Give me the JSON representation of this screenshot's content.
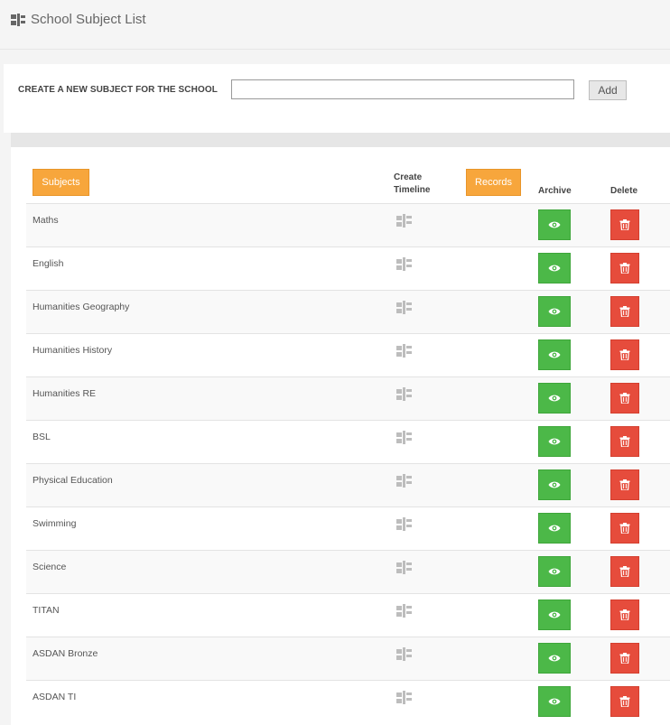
{
  "header": {
    "title": "School Subject List",
    "logo_icon": "timeline-flag-icon"
  },
  "create": {
    "label": "CREATE A NEW SUBJECT FOR THE SCHOOL",
    "input_value": "",
    "add_label": "Add"
  },
  "list": {
    "subjects_button": "Subjects",
    "timeline_header": "Create Timeline",
    "records_button": "Records",
    "archive_header": "Archive",
    "delete_header": "Delete",
    "subjects": [
      "Maths",
      "English",
      "Humanities Geography",
      "Humanities History",
      "Humanities RE",
      "BSL",
      "Physical Education",
      "Swimming",
      "Science",
      "TITAN",
      "ASDAN Bronze",
      "ASDAN TI"
    ]
  },
  "colors": {
    "archive_green": "#4cb848",
    "delete_red": "#e64c3c",
    "accent_orange": "#f7a63c"
  },
  "icons": {
    "timeline": "timeline-flag-icon",
    "archive": "eye-icon",
    "delete": "trash-icon"
  }
}
